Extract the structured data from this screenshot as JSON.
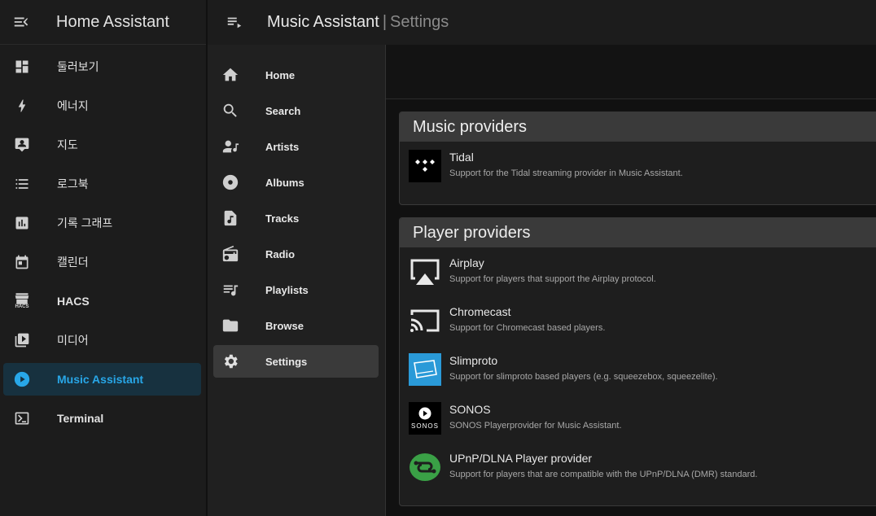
{
  "app": {
    "title": "Home Assistant"
  },
  "sidebar": {
    "items": [
      {
        "label": "둘러보기",
        "icon": "dashboard-icon"
      },
      {
        "label": "에너지",
        "icon": "lightning-icon"
      },
      {
        "label": "지도",
        "icon": "map-person-icon"
      },
      {
        "label": "로그북",
        "icon": "logbook-icon"
      },
      {
        "label": "기록 그래프",
        "icon": "history-chart-icon"
      },
      {
        "label": "캘린더",
        "icon": "calendar-icon"
      },
      {
        "label": "HACS",
        "icon": "hacs-store-icon",
        "icon_text": "HACS"
      },
      {
        "label": "미디어",
        "icon": "media-icon"
      },
      {
        "label": "Music Assistant",
        "icon": "play-circle-icon",
        "active": true
      },
      {
        "label": "Terminal",
        "icon": "terminal-icon"
      }
    ]
  },
  "topbar": {
    "title": "Music Assistant",
    "separator": "|",
    "subtitle": "Settings"
  },
  "ma_nav": {
    "items": [
      {
        "label": "Home",
        "icon": "home-icon"
      },
      {
        "label": "Search",
        "icon": "search-icon"
      },
      {
        "label": "Artists",
        "icon": "artist-icon"
      },
      {
        "label": "Albums",
        "icon": "album-icon"
      },
      {
        "label": "Tracks",
        "icon": "track-icon"
      },
      {
        "label": "Radio",
        "icon": "radio-icon"
      },
      {
        "label": "Playlists",
        "icon": "playlist-icon"
      },
      {
        "label": "Browse",
        "icon": "folder-icon"
      },
      {
        "label": "Settings",
        "icon": "gear-icon",
        "active": true
      }
    ]
  },
  "music_providers": {
    "title": "Music providers",
    "items": [
      {
        "name": "Tidal",
        "description": "Support for the Tidal streaming provider in Music Assistant.",
        "icon": "tidal-logo"
      }
    ]
  },
  "player_providers": {
    "title": "Player providers",
    "items": [
      {
        "name": "Airplay",
        "description": "Support for players that support the Airplay protocol.",
        "icon": "airplay-logo"
      },
      {
        "name": "Chromecast",
        "description": "Support for Chromecast based players.",
        "icon": "chromecast-logo"
      },
      {
        "name": "Slimproto",
        "description": "Support for slimproto based players (e.g. squeezebox, squeezelite).",
        "icon": "slimproto-logo"
      },
      {
        "name": "SONOS",
        "description": "SONOS Playerprovider for Music Assistant.",
        "icon": "sonos-logo",
        "logo_text": "SONOS"
      },
      {
        "name": "UPnP/DLNA Player provider",
        "description": "Support for players that are compatible with the UPnP/DLNA (DMR) standard.",
        "icon": "upnp-logo"
      }
    ]
  },
  "colors": {
    "accent": "#28a7e8",
    "upnp_green": "#3aa046",
    "slimproto_blue": "#2a9ad8"
  }
}
